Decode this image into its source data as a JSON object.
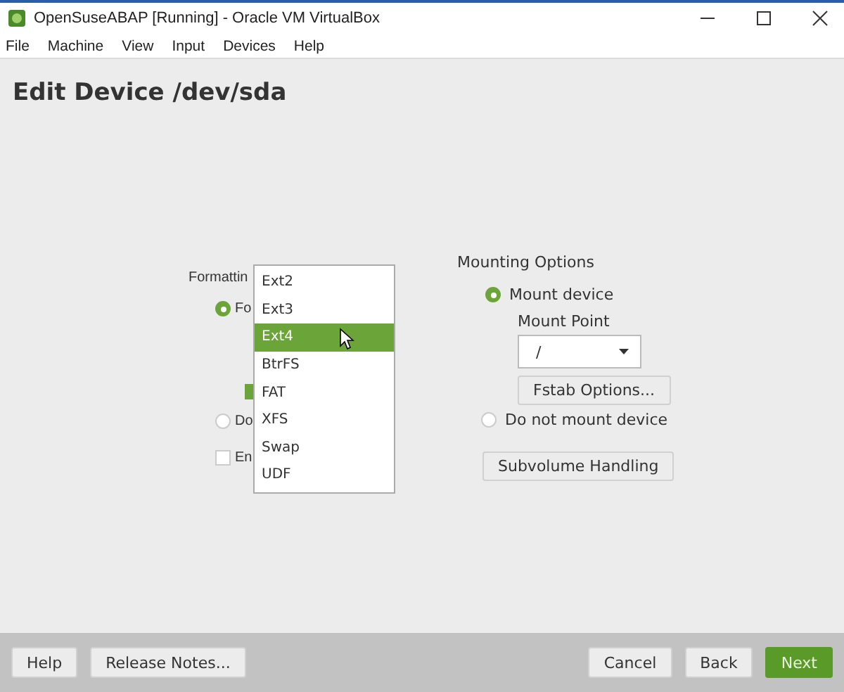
{
  "window": {
    "title": "OpenSuseABAP [Running] - Oracle VM VirtualBox"
  },
  "menu": [
    "File",
    "Machine",
    "View",
    "Input",
    "Devices",
    "Help"
  ],
  "heading": "Edit Device /dev/sda",
  "formatting": {
    "label": "Formattin",
    "options": [
      {
        "kind": "radio",
        "label": "Fo",
        "selected": true
      },
      {
        "kind": "checkbox",
        "checked": true
      },
      {
        "kind": "radio",
        "label": "Do",
        "selected": false
      },
      {
        "kind": "checkbox",
        "label": "En",
        "checked": false
      }
    ]
  },
  "filesystem_dropdown": {
    "items": [
      {
        "label": "Ext2",
        "selected": false
      },
      {
        "label": "Ext3",
        "selected": false
      },
      {
        "label": "Ext4",
        "selected": true
      },
      {
        "label": "BtrFS",
        "selected": false
      },
      {
        "label": "FAT",
        "selected": false
      },
      {
        "label": "XFS",
        "selected": false
      },
      {
        "label": "Swap",
        "selected": false
      },
      {
        "label": "UDF",
        "selected": false
      }
    ]
  },
  "mounting": {
    "label": "Mounting Options",
    "mount": {
      "label": "Mount device",
      "selected": true
    },
    "mount_point": {
      "label": "Mount Point",
      "value": "/"
    },
    "fstab_button": "Fstab Options...",
    "no_mount": {
      "label": "Do not mount device",
      "selected": false
    },
    "subvolume_button": "Subvolume Handling"
  },
  "footer": {
    "left": [
      {
        "label": "Help",
        "kind": "normal"
      },
      {
        "label": "Release Notes...",
        "kind": "normal"
      }
    ],
    "right": [
      {
        "label": "Cancel",
        "kind": "normal"
      },
      {
        "label": "Back",
        "kind": "normal"
      },
      {
        "label": "Next",
        "kind": "primary"
      }
    ]
  }
}
